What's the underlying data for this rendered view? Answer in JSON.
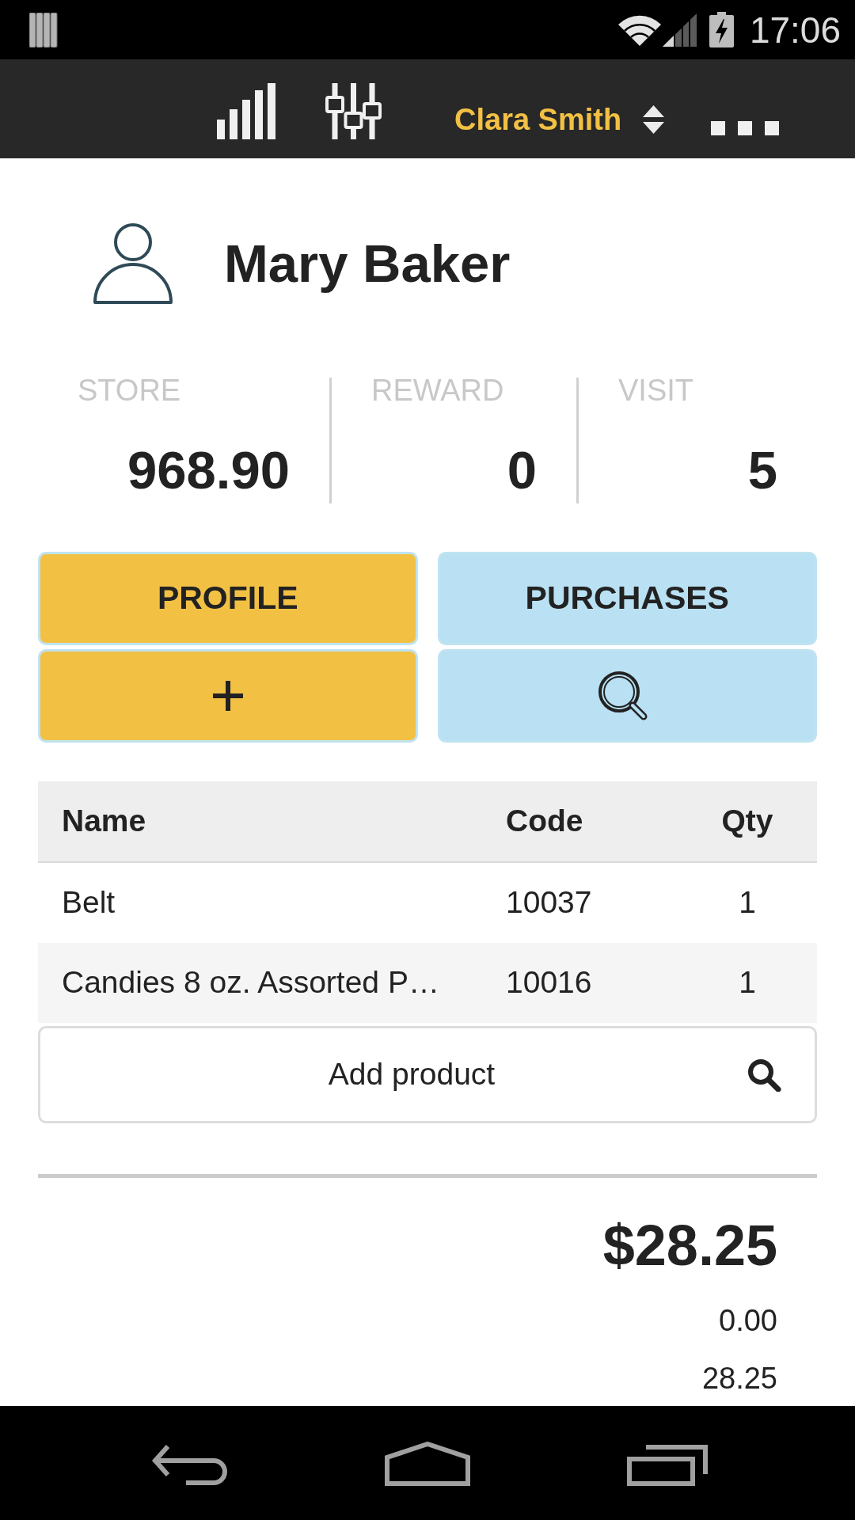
{
  "status_bar": {
    "time": "17:06"
  },
  "toolbar": {
    "user": "Clara Smith"
  },
  "customer": {
    "name": "Mary Baker"
  },
  "stats": [
    {
      "label": "STORE",
      "value": "968.90"
    },
    {
      "label": "REWARD",
      "value": "0"
    },
    {
      "label": "VISIT",
      "value": "5"
    }
  ],
  "actions": [
    {
      "kind": "text",
      "label": "PROFILE",
      "color": "#f2c144"
    },
    {
      "kind": "text",
      "label": "PURCHASES",
      "color": "#b9e1f3"
    },
    {
      "kind": "add",
      "color": "#f2c144"
    },
    {
      "kind": "search",
      "color": "#b9e1f3"
    }
  ],
  "table": {
    "columns": [
      "Name",
      "Code",
      "Qty"
    ],
    "rows": [
      [
        "Belt",
        "10037",
        "1"
      ],
      [
        "Candies 8 oz. Assorted P…",
        "10016",
        "1"
      ]
    ]
  },
  "add_product": {
    "label": "Add product"
  },
  "totals": {
    "total": "$28.25",
    "lines": [
      "0.00",
      "28.25"
    ]
  }
}
